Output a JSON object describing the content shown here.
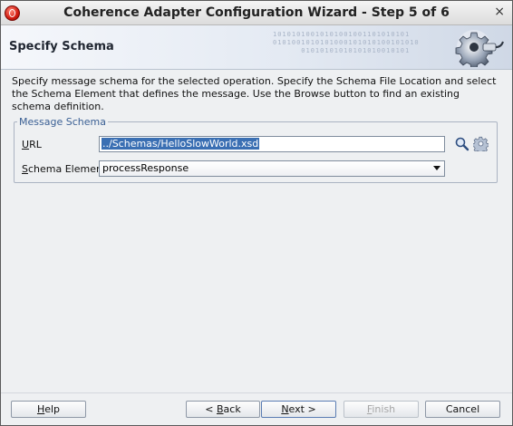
{
  "window": {
    "title": "Coherence Adapter Configuration Wizard - Step 5 of 6",
    "close_glyph": "×",
    "icon": "oracle-app-icon"
  },
  "header": {
    "title": "Specify Schema",
    "binary_text": "10101010010101001001101010101\n0101001010101000101010100101010\n      01010101010101010010101",
    "icon": "gear-plug-icon"
  },
  "description": "Specify message schema for the selected operation. Specify the Schema File Location and select the Schema Element that defines the message. Use the Browse button to find an existing schema definition.",
  "message_schema": {
    "legend": "Message Schema",
    "url": {
      "label_mnemonic": "U",
      "label_rest": "RL",
      "value": "../Schemas/HelloSlowWorld.xsd",
      "browse_icon": "search-icon",
      "generate_icon": "gear-icon"
    },
    "schema_element": {
      "label_mnemonic": "S",
      "label_rest": "chema Element",
      "selected": "processResponse"
    }
  },
  "buttons": {
    "help": {
      "mnemonic": "H",
      "rest": "elp"
    },
    "back": {
      "prefix": "< ",
      "mnemonic": "B",
      "rest": "ack"
    },
    "next": {
      "mnemonic": "N",
      "rest": "ext >"
    },
    "finish": {
      "mnemonic": "F",
      "rest": "inish",
      "enabled": false
    },
    "cancel": {
      "label": "Cancel"
    }
  },
  "colors": {
    "legend_text": "#3a5f94",
    "selection": "#3a6fb3",
    "brand_red": "#d21b10"
  }
}
